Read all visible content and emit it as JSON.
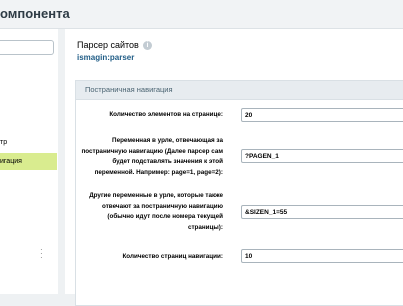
{
  "header": {
    "title": "омпонента"
  },
  "sidebar": {
    "items": [
      {
        "label": "тр"
      },
      {
        "label": "игация"
      }
    ]
  },
  "component": {
    "name": "Парсер сайтов",
    "code": "ismagin:parser",
    "info_icon": "i"
  },
  "section": {
    "title": "Постраничная навигация",
    "params": [
      {
        "label": "Количество элементов на странице:",
        "value": "20"
      },
      {
        "label": "Переменная в урле, отвечающая за постраничную навигацию (Далее парсер сам будет подставлять значения к этой переменной. Например: page=1, page=2):",
        "value": "?PAGEN_1"
      },
      {
        "label": "Другие переменные в урле, которые также отвечают за постраничную навигацию (обычно идут после номера текущей страницы):",
        "value": "&SIZEN_1=55"
      },
      {
        "label": "Количество страниц навигации:",
        "value": "10"
      }
    ]
  },
  "colors": {
    "active_item": "#d9ec8f",
    "link": "#1f5c86",
    "section_header": "#e7ecf0"
  }
}
